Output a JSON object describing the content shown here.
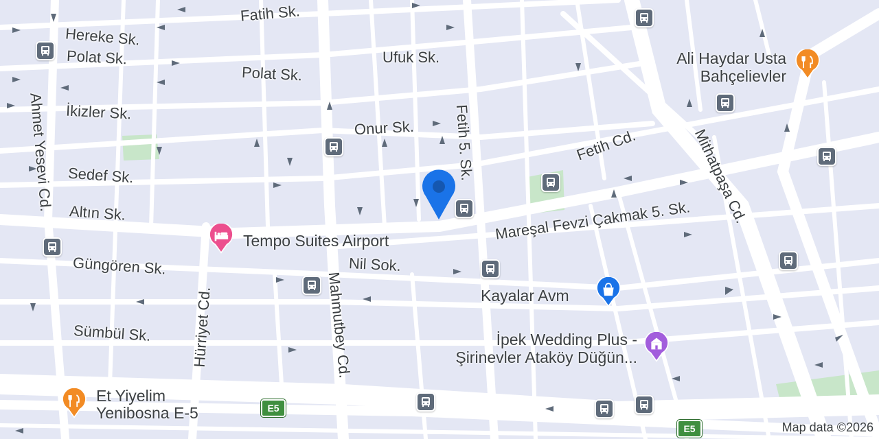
{
  "streets": {
    "fatih_sk": "Fatih Sk.",
    "hereke_sk": "Hereke Sk.",
    "polat_sk_1": "Polat Sk.",
    "polat_sk_2": "Polat Sk.",
    "ufuk_sk": "Ufuk Sk.",
    "ikizler_sk": "İkizler Sk.",
    "onur_sk": "Onur Sk.",
    "sedef_sk": "Sedef Sk.",
    "altin_sk": "Altın Sk.",
    "ahmet_yesevi_cd": "Ahmet Yesevi Cd.",
    "fetih_5_sk": "Fetih 5. Sk.",
    "fetih_cd": "Fetih Cd.",
    "mithatpasa_cd": "Mithatpaşa Cd.",
    "maresal": "Mareşal Fevzi Çakmak 5. Sk.",
    "nil_sok": "Nil Sok.",
    "gungoren_sk": "Güngören Sk.",
    "hurriyet_cd": "Hürriyet Cd.",
    "mahmutbey_cd": "Mahmutbey Cd.",
    "sumbul_sk": "Sümbül Sk."
  },
  "pois": {
    "ali_haydar_line1": "Ali Haydar Usta",
    "ali_haydar_line2": "Bahçelievler",
    "tempo_suites": "Tempo Suites Airport",
    "kayalar_avm": "Kayalar Avm",
    "ipek_line1": "İpek Wedding Plus -",
    "ipek_line2": "Şirinevler Ataköy Düğün...",
    "et_yiyelim_line1": "Et Yiyelim",
    "et_yiyelim_line2": "Yenibosna E-5"
  },
  "road_shields": {
    "e5_left": "E5",
    "e5_right": "E5"
  },
  "attribution": "Map data ©2026",
  "colors": {
    "restaurant": "#f28b24",
    "hotel": "#ec4f8e",
    "shopping": "#1a73e8",
    "wedding": "#a25ddc",
    "location_pin": "#1a73e8",
    "bus_stop": "#5f6b7a",
    "park": "#c8e6c9",
    "highway_shield": "#3f8f3f"
  },
  "icons": [
    "bus-stop-icon",
    "restaurant-icon",
    "hotel-icon",
    "shopping-bag-icon",
    "wedding-icon",
    "location-pin-icon"
  ]
}
